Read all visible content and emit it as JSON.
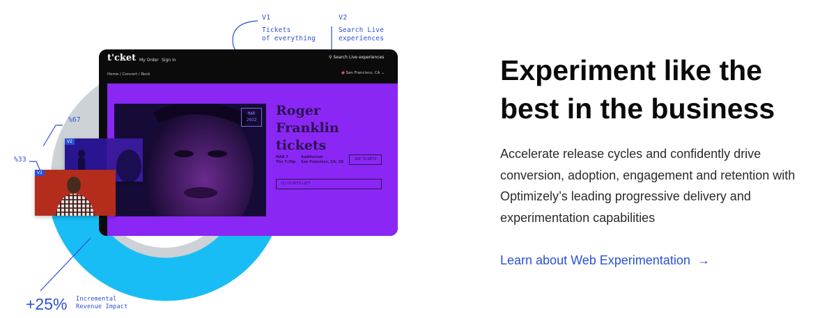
{
  "annotations": {
    "v1": {
      "tag": "V1",
      "line1": "Tickets",
      "line2": "of everything"
    },
    "v2": {
      "tag": "V2",
      "line1": "Search Live",
      "line2": "experiences"
    },
    "pct67": "%67",
    "pct33": "%33",
    "impact_value": "+25%",
    "impact_line1": "Incremental",
    "impact_line2": "Revenue Impact"
  },
  "mockup": {
    "logo": "t'cket",
    "nav": [
      "My Order",
      "Sign in"
    ],
    "search": "Search Live experiences",
    "breadcrumb": "Home / Concert / Rock",
    "location": "San Francisco, CA",
    "date_box": {
      "month": "MAR",
      "year": "2022"
    },
    "event_title": "Roger Franklin tickets",
    "event_date": {
      "line1": "MAR 7",
      "line2": "Thu 7:30p"
    },
    "event_venue": {
      "line1": "Auditorium",
      "line2": "San Francisco, CA, US"
    },
    "see_tickets": "SEE TICKETS",
    "tickets_left": "(1) TICKETS LEFT",
    "variant_tags": [
      "V2",
      "V1"
    ]
  },
  "content": {
    "heading_line1": "Experiment like the",
    "heading_line2": "best in the business",
    "body_lines": [
      "Accelerate release cycles and confidently drive",
      "conversion, adoption, engagement and retention with",
      "Optimizely’s leading progressive delivery and",
      "experimentation capabilities"
    ],
    "cta": "Learn about Web Experimentation",
    "cta_arrow": "→"
  },
  "colors": {
    "accent_blue": "#2a4fd6",
    "donut_cyan": "#19bdf5",
    "donut_grey": "#cdd2d6",
    "hero_purple": "#8b27f5"
  }
}
